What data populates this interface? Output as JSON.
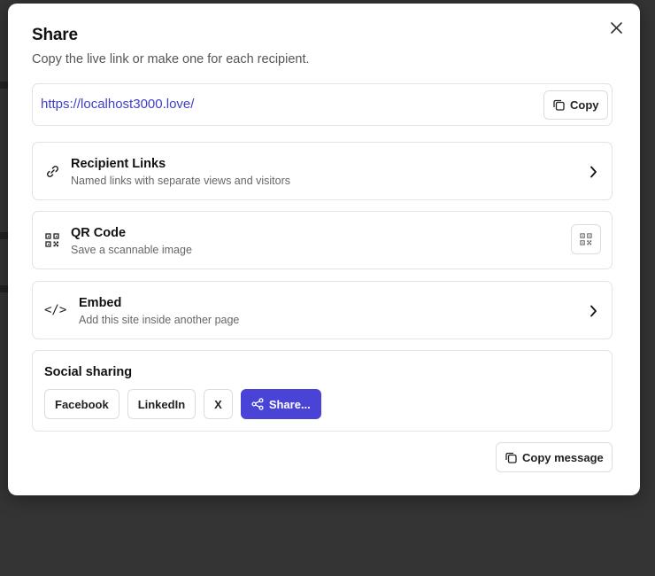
{
  "dialog": {
    "title": "Share",
    "subtitle": "Copy the live link or make one for each recipient."
  },
  "link": {
    "url": "https://localhost3000.love/",
    "copy_label": "Copy"
  },
  "options": [
    {
      "title": "Recipient Links",
      "description": "Named links with separate views and visitors",
      "icon": "link-icon"
    },
    {
      "title": "QR Code",
      "description": "Save a scannable image",
      "icon": "qr-code-icon"
    },
    {
      "title": "Embed",
      "description": "Add this site inside another page",
      "icon": "code-icon",
      "icon_text": "</>"
    }
  ],
  "social": {
    "title": "Social sharing",
    "buttons": [
      "Facebook",
      "LinkedIn",
      "X",
      "Share..."
    ]
  },
  "footer": {
    "copy_message_label": "Copy message"
  },
  "colors": {
    "accent": "#4a44d6",
    "link": "#3f3fc7",
    "backdrop": "#343434"
  }
}
